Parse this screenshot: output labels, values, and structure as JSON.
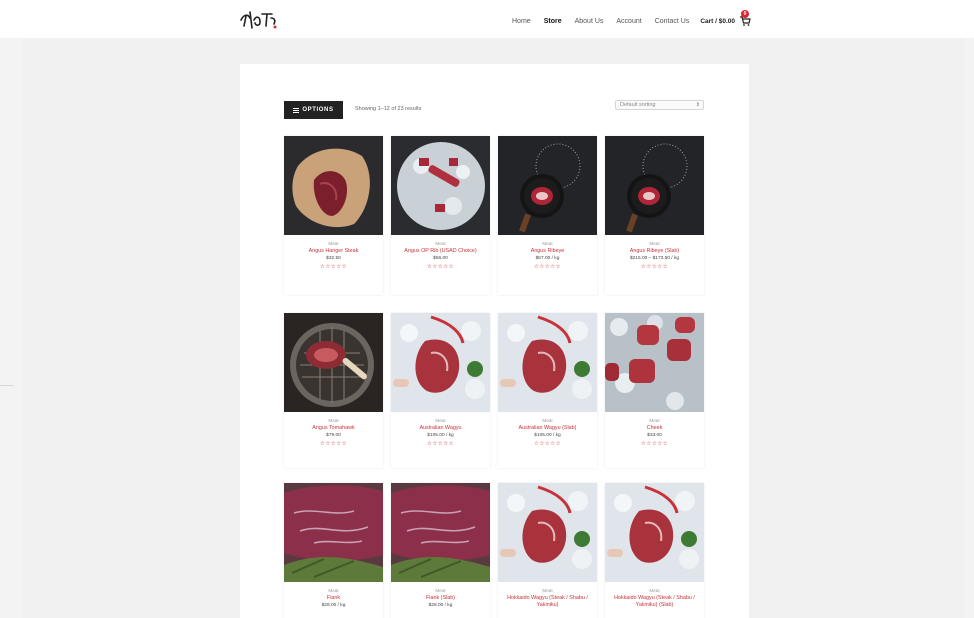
{
  "colors": {
    "accent": "#c8323a",
    "dark": "#222222",
    "badge": "#d9232d"
  },
  "header": {
    "logo_icon": "brand-logo-icon",
    "nav": [
      {
        "label": "Home",
        "active": false
      },
      {
        "label": "Store",
        "active": true
      },
      {
        "label": "About Us",
        "active": false
      },
      {
        "label": "Account",
        "active": false
      },
      {
        "label": "Contact Us",
        "active": false
      }
    ],
    "cart_label": "Cart / $0.00",
    "cart_icon": "cart-icon",
    "cart_count": "0"
  },
  "toolbar": {
    "options_label": "OPTIONS",
    "options_icon": "menu-icon",
    "results_text": "Showing 1–12 of 23 results",
    "sorting_value": "Default sorting",
    "sorting_icon": "chevron-updown-icon"
  },
  "products": [
    {
      "category": "Meat",
      "name": "Angus Hanger Steak",
      "price": "$32.50",
      "rating": "☆☆☆☆☆",
      "image": "steak-on-paper"
    },
    {
      "category": "Meat",
      "name": "Angus OP Rib (USAD Choice)",
      "price": "$56.00",
      "rating": "☆☆☆☆☆",
      "image": "meat-on-ice"
    },
    {
      "category": "Meat",
      "name": "Angus Ribeye",
      "price": "$57.00 / kg",
      "rating": "☆☆☆☆☆",
      "image": "ribeye-in-pan"
    },
    {
      "category": "Meat",
      "name": "Angus Ribeye (Slab)",
      "price": "$215.00 – $173.50 / kg",
      "rating": "☆☆☆☆☆",
      "image": "ribeye-in-pan"
    },
    {
      "category": "Meat",
      "name": "Angus Tomahawk",
      "price": "$79.00",
      "rating": "☆☆☆☆☆",
      "image": "tomahawk-on-grill"
    },
    {
      "category": "Meat",
      "name": "Australian Wagyu",
      "price": "$105.00 / kg",
      "rating": "☆☆☆☆☆",
      "image": "wagyu-on-ice"
    },
    {
      "category": "Meat",
      "name": "Australian Wagyu (Slab)",
      "price": "$105.00 / kg",
      "rating": "☆☆☆☆☆",
      "image": "wagyu-on-ice"
    },
    {
      "category": "Meat",
      "name": "Cheek",
      "price": "$33.00",
      "rating": "☆☆☆☆☆",
      "image": "cheek-on-ice"
    },
    {
      "category": "Meat",
      "name": "Flank",
      "price": "$28.00 / kg",
      "rating": "",
      "image": "flank-steak"
    },
    {
      "category": "Meat",
      "name": "Flank (Slab)",
      "price": "$28.00 / kg",
      "rating": "",
      "image": "flank-steak"
    },
    {
      "category": "Meat",
      "name": "Hokkaido Wagyu (Steak / Shabu / Yakiniku)",
      "price": "",
      "rating": "",
      "image": "wagyu-on-ice"
    },
    {
      "category": "Meat",
      "name": "Hokkaido Wagyu (Steak / Shabu / Yakiniku) (Slab)",
      "price": "",
      "rating": "",
      "image": "wagyu-on-ice"
    }
  ]
}
